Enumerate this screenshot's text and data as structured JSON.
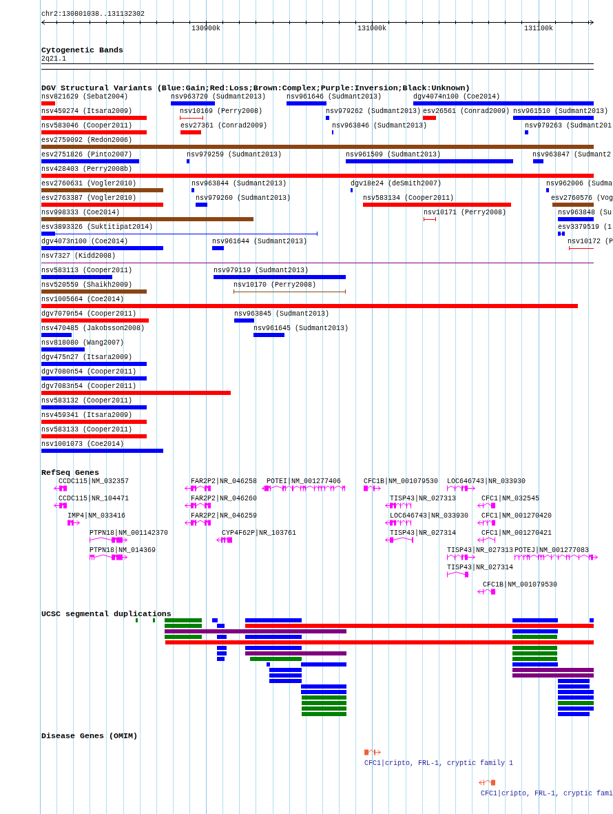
{
  "ruler": {
    "region": "chr2:130801038..131132302",
    "ticks": [
      "130900k",
      "131000k",
      "131100k"
    ]
  },
  "cytogenetic_bands": {
    "title": "Cytogenetic Bands",
    "bands": [
      {
        "label": "2q21.1"
      }
    ]
  },
  "dgv": {
    "title": "DGV Structural Variants (Blue:Gain;Red:Loss;Brown:Complex;Purple:Inversion;Black:Unknown)",
    "features": [
      {
        "label": "nsv821629 (Sebat2004)",
        "color": "#ff0000",
        "kind": "bar"
      },
      {
        "label": "nsv963720 (Sudmant2013)",
        "color": "#0000ff",
        "kind": "bar"
      },
      {
        "label": "nsv961646 (Sudmant2013)",
        "color": "#0000ff",
        "kind": "bar"
      },
      {
        "label": "dgv4074n100 (Coe2014)",
        "color": "#0000ff",
        "kind": "bar"
      },
      {
        "label": "nsv459274 (Itsara2009)",
        "color": "#ff0000",
        "kind": "bar"
      },
      {
        "label": "nsv10169 (Perry2008)",
        "color": "#ff0000",
        "kind": "span"
      },
      {
        "label": "nsv979262 (Sudmant2013)",
        "color": "#0000ff",
        "kind": "bar"
      },
      {
        "label": "esv26561 (Conrad2009)",
        "color": "#ff0000",
        "kind": "bar"
      },
      {
        "label": "nsv961510 (Sudmant2013)",
        "color": "#0000ff",
        "kind": "bar"
      },
      {
        "label": "nsv583046 (Cooper2011)",
        "color": "#ff0000",
        "kind": "bar"
      },
      {
        "label": "esv27361 (Conrad2009)",
        "color": "#ff0000",
        "kind": "bar"
      },
      {
        "label": "nsv963846 (Sudmant2013)",
        "color": "#0000ff",
        "kind": "bar"
      },
      {
        "label": "nsv979263 (Sudmant201",
        "color": "#0000ff",
        "kind": "bar"
      },
      {
        "label": "esv2759092 (Redon2006)",
        "color": "#8b4513",
        "kind": "bar"
      },
      {
        "label": "esv2751826 (Pinto2007)",
        "color": "#0000ff",
        "kind": "bar"
      },
      {
        "label": "nsv979259 (Sudmant2013)",
        "color": "#0000ff",
        "kind": "bar"
      },
      {
        "label": "nsv961509 (Sudmant2013)",
        "color": "#0000ff",
        "kind": "bar"
      },
      {
        "label": "nsv963847 (Sudmant2",
        "color": "#0000ff",
        "kind": "bar"
      },
      {
        "label": "nsv428403 (Perry2008b)",
        "color": "#ff0000",
        "kind": "bar"
      },
      {
        "label": "esv2760631 (Vogler2010)",
        "color": "#8b4513",
        "kind": "bar"
      },
      {
        "label": "nsv963844 (Sudmant2013)",
        "color": "#0000ff",
        "kind": "bar"
      },
      {
        "label": "dgv18e24 (deSmith2007)",
        "color": "#0000ff",
        "kind": "bar"
      },
      {
        "label": "nsv962006 (Sudma",
        "color": "#0000ff",
        "kind": "bar"
      },
      {
        "label": "esv2763387 (Vogler2010)",
        "color": "#ff0000",
        "kind": "bar"
      },
      {
        "label": "nsv979260 (Sudmant2013)",
        "color": "#0000ff",
        "kind": "bar"
      },
      {
        "label": "nsv583134 (Cooper2011)",
        "color": "#ff0000",
        "kind": "bar"
      },
      {
        "label": "esv2760576 (Vog",
        "color": "#8b4513",
        "kind": "bar"
      },
      {
        "label": "nsv998333 (Coe2014)",
        "color": "#8b4513",
        "kind": "bar"
      },
      {
        "label": "nsv10171 (Perry2008)",
        "color": "#ff0000",
        "kind": "span"
      },
      {
        "label": "nsv963848 (Su",
        "color": "#0000ff",
        "kind": "bar"
      },
      {
        "label": "esv3893326 (Suktitipat2014)",
        "color": "#0000ff",
        "kind": "span"
      },
      {
        "label": "esv3379519 (1",
        "color": "#0000ff",
        "kind": "span"
      },
      {
        "label": "dgv4073n100 (Coe2014)",
        "color": "#0000ff",
        "kind": "bar"
      },
      {
        "label": "nsv961644 (Sudmant2013)",
        "color": "#0000ff",
        "kind": "bar"
      },
      {
        "label": "nsv10172 (P",
        "color": "#ff0000",
        "kind": "span"
      },
      {
        "label": "nsv7327 (Kidd2008)",
        "color": "#800080",
        "kind": "span"
      },
      {
        "label": "nsv583113 (Cooper2011)",
        "color": "#0000ff",
        "kind": "bar"
      },
      {
        "label": "nsv979119 (Sudmant2013)",
        "color": "#0000ff",
        "kind": "bar"
      },
      {
        "label": "nsv520559 (Shaikh2009)",
        "color": "#8b4513",
        "kind": "bar"
      },
      {
        "label": "nsv10170 (Perry2008)",
        "color": "#8b4513",
        "kind": "span"
      },
      {
        "label": "nsv1005664 (Coe2014)",
        "color": "#ff0000",
        "kind": "bar"
      },
      {
        "label": "dgv7079n54 (Cooper2011)",
        "color": "#ff0000",
        "kind": "bar"
      },
      {
        "label": "nsv963845 (Sudmant2013)",
        "color": "#0000ff",
        "kind": "bar"
      },
      {
        "label": "nsv470485 (Jakobsson2008)",
        "color": "#0000ff",
        "kind": "bar"
      },
      {
        "label": "nsv961645 (Sudmant2013)",
        "color": "#0000ff",
        "kind": "bar"
      },
      {
        "label": "nsv818080 (Wang2007)",
        "color": "#0000ff",
        "kind": "bar"
      },
      {
        "label": "dgv475n27 (Itsara2009)",
        "color": "#0000ff",
        "kind": "bar"
      },
      {
        "label": "dgv7080n54 (Cooper2011)",
        "color": "#0000ff",
        "kind": "bar"
      },
      {
        "label": "dgv7083n54 (Cooper2011)",
        "color": "#ff0000",
        "kind": "bar"
      },
      {
        "label": "nsv583132 (Cooper2011)",
        "color": "#0000ff",
        "kind": "bar"
      },
      {
        "label": "nsv459341 (Itsara2009)",
        "color": "#ff0000",
        "kind": "bar"
      },
      {
        "label": "nsv583133 (Cooper2011)",
        "color": "#ff0000",
        "kind": "bar"
      },
      {
        "label": "nsv1001073 (Coe2014)",
        "color": "#0000ff",
        "kind": "bar"
      }
    ]
  },
  "refseq_genes": {
    "title": "RefSeq Genes",
    "genes": [
      {
        "label": "CCDC115|NM_032357",
        "kind": "reverse"
      },
      {
        "label": "FAR2P2|NR_046258",
        "kind": "reverse"
      },
      {
        "label": "POTEI|NM_001277406",
        "kind": "reverse"
      },
      {
        "label": "CFC1B|NM_001079530",
        "kind": "forward"
      },
      {
        "label": "LOC646743|NR_033930",
        "kind": "forward"
      },
      {
        "label": "CCDC115|NR_104471",
        "kind": "reverse"
      },
      {
        "label": "FAR2P2|NR_046260",
        "kind": "reverse"
      },
      {
        "label": "TISP43|NR_027313",
        "kind": "reverse"
      },
      {
        "label": "CFC1|NM_032545",
        "kind": "reverse"
      },
      {
        "label": "IMP4|NM_033416",
        "kind": "forward"
      },
      {
        "label": "FAR2P2|NR_046259",
        "kind": "reverse"
      },
      {
        "label": "LOC646743|NR_033930",
        "kind": "reverse"
      },
      {
        "label": "CFC1|NM_001270420",
        "kind": "reverse"
      },
      {
        "label": "PTPN18|NM_001142370",
        "kind": "forward"
      },
      {
        "label": "CYP4F62P|NR_103761",
        "kind": "reverse"
      },
      {
        "label": "TISP43|NR_027314",
        "kind": "reverse"
      },
      {
        "label": "CFC1|NM_001270421",
        "kind": "reverse"
      },
      {
        "label": "PTPN18|NM_014369",
        "kind": "forward"
      },
      {
        "label": "TISP43|NR_027313",
        "kind": "forward"
      },
      {
        "label": "POTEJ|NM_001277083",
        "kind": "forward"
      },
      {
        "label": "TISP43|NR_027314",
        "kind": "plain"
      },
      {
        "label": "CFC1B|NM_001079530",
        "kind": "reverse"
      }
    ]
  },
  "segmental_duplications": {
    "title": "UCSC segmental duplications",
    "features": [
      {
        "color": "#008000"
      },
      {
        "color": "#008000"
      },
      {
        "color": "#008000"
      },
      {
        "color": "#0000ff"
      },
      {
        "color": "#0000ff"
      },
      {
        "color": "#0000ff"
      },
      {
        "color": "#0000ff"
      },
      {
        "color": "#008000"
      },
      {
        "color": "#0000ff"
      },
      {
        "color": "#ff0000"
      },
      {
        "color": "#800080"
      },
      {
        "color": "#0000ff"
      },
      {
        "color": "#008000"
      },
      {
        "color": "#0000ff"
      },
      {
        "color": "#0000ff"
      },
      {
        "color": "#008000"
      },
      {
        "color": "#ff0000"
      },
      {
        "color": "#0000ff"
      },
      {
        "color": "#0000ff"
      },
      {
        "color": "#008000"
      },
      {
        "color": "#0000ff"
      },
      {
        "color": "#800080"
      },
      {
        "color": "#008000"
      },
      {
        "color": "#0000ff"
      },
      {
        "color": "#008000"
      },
      {
        "color": "#008000"
      },
      {
        "color": "#0000ff"
      },
      {
        "color": "#0000ff"
      },
      {
        "color": "#0000ff"
      },
      {
        "color": "#0000ff"
      },
      {
        "color": "#800080"
      },
      {
        "color": "#0000ff"
      },
      {
        "color": "#800080"
      },
      {
        "color": "#0000ff"
      },
      {
        "color": "#0000ff"
      },
      {
        "color": "#0000ff"
      },
      {
        "color": "#0000ff"
      },
      {
        "color": "#0000ff"
      },
      {
        "color": "#0000ff"
      },
      {
        "color": "#008000"
      },
      {
        "color": "#0000ff"
      },
      {
        "color": "#008000"
      },
      {
        "color": "#008000"
      },
      {
        "color": "#008000"
      },
      {
        "color": "#0000ff"
      },
      {
        "color": "#008000"
      },
      {
        "color": "#0000ff"
      }
    ]
  },
  "disease_genes": {
    "title": "Disease Genes (OMIM)",
    "genes": [
      {
        "label": "CFC1|cripto, FRL-1, cryptic family 1",
        "kind": "forward"
      },
      {
        "label": "CFC1|cripto, FRL-1, cryptic fami",
        "kind": "reverse"
      }
    ]
  }
}
